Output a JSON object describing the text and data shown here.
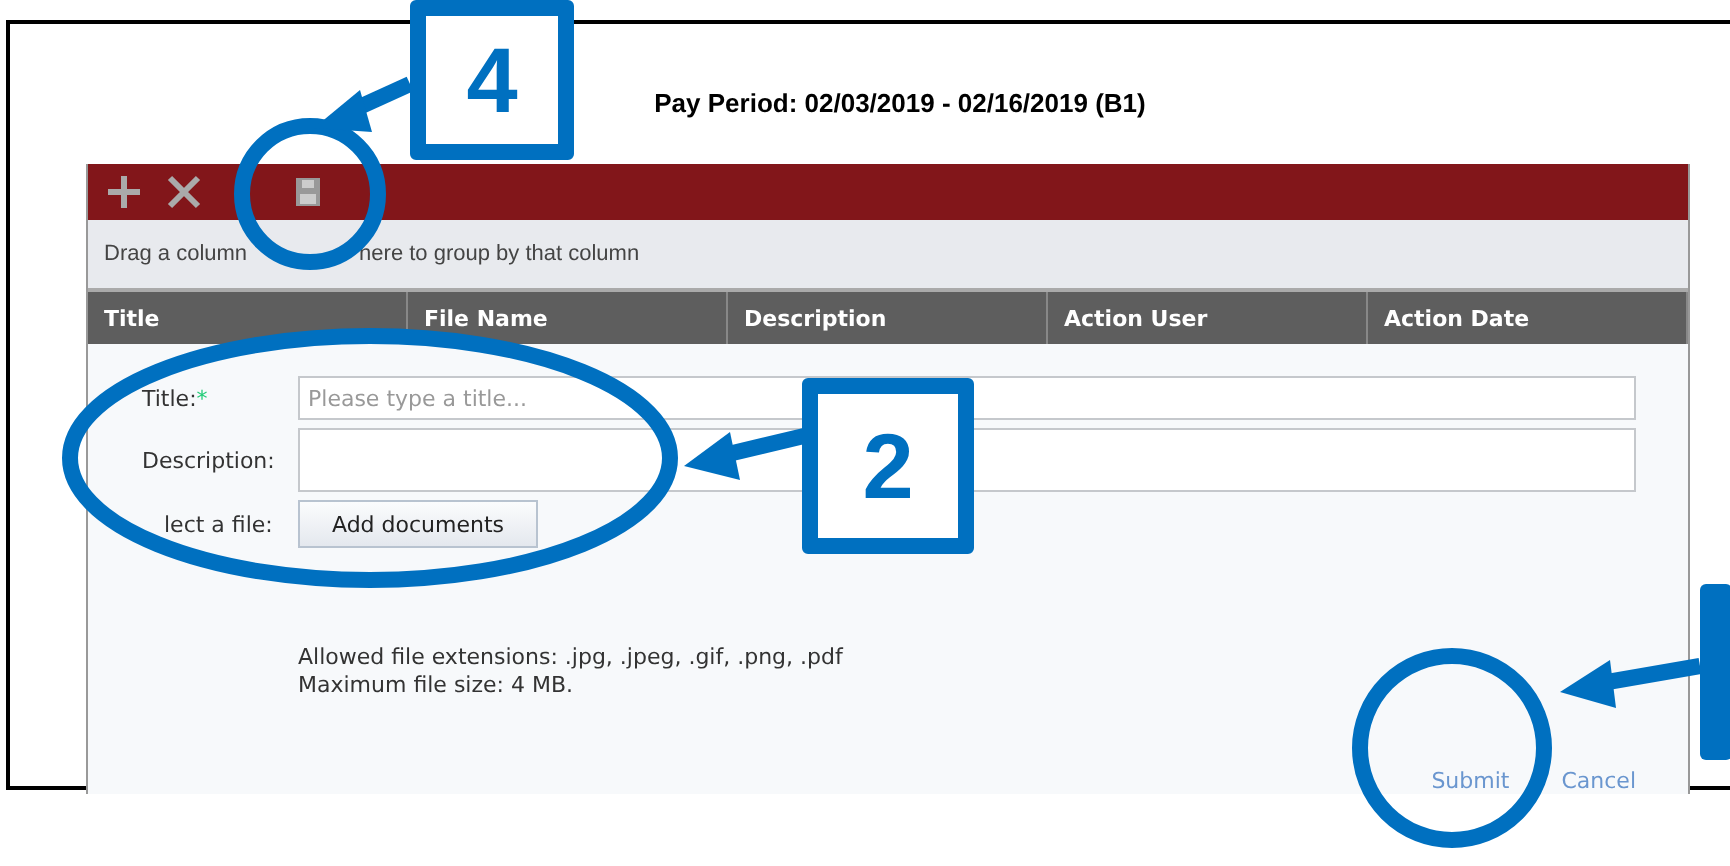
{
  "page_title": "Pay Period: 02/03/2019 - 02/16/2019 (B1)",
  "group_bar": [
    "Drag a column",
    "here to group by that column"
  ],
  "columns": [
    "Title",
    "File Name",
    "Description",
    "Action User",
    "Action Date"
  ],
  "form": {
    "fields": [
      {
        "label": "Title:",
        "required_mark": "*",
        "placeholder": "Please type a title...",
        "kind": "input"
      },
      {
        "label": "Description:",
        "kind": "textarea"
      }
    ],
    "file_label": "lect a file:",
    "file_button": "Add documents",
    "notes": [
      "Allowed file extensions: .jpg, .jpeg, .gif, .png, .pdf",
      "Maximum file size: 4 MB."
    ],
    "actions": [
      "Submit",
      "Cancel"
    ]
  },
  "callouts": [
    "4",
    "2"
  ]
}
